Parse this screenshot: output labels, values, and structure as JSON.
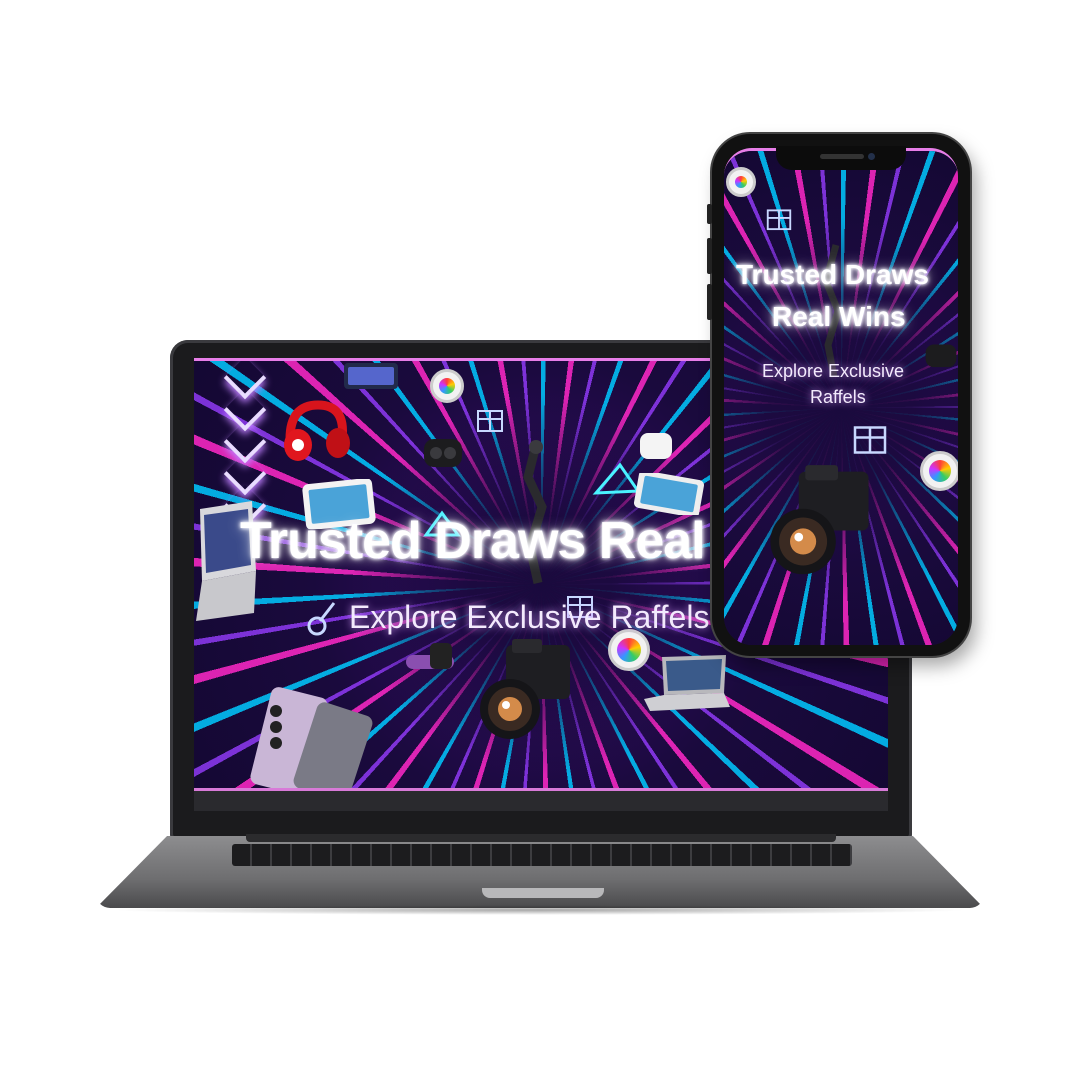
{
  "laptop": {
    "hero_title": "Trusted Draws Real",
    "hero_subtitle": "Explore Exclusive Raffels"
  },
  "phone": {
    "hero_title_line1": "Trusted Draws",
    "hero_title_line2": "Real Wins",
    "hero_subtitle_line1": "Explore Exclusive",
    "hero_subtitle_line2": "Raffels"
  },
  "colors": {
    "neon_cyan": "#00c8ff",
    "neon_pink": "#ff28c8",
    "neon_purple": "#963cff",
    "background_deep": "#1a0a3d",
    "accent_border": "#e77ee8"
  },
  "icons": [
    "headphones-icon",
    "gift-icon",
    "camera-icon",
    "smartwatch-icon",
    "tablet-icon",
    "earbuds-icon",
    "smartphone-icon",
    "laptop-icon",
    "guitar-icon",
    "chevron-down-icon"
  ]
}
